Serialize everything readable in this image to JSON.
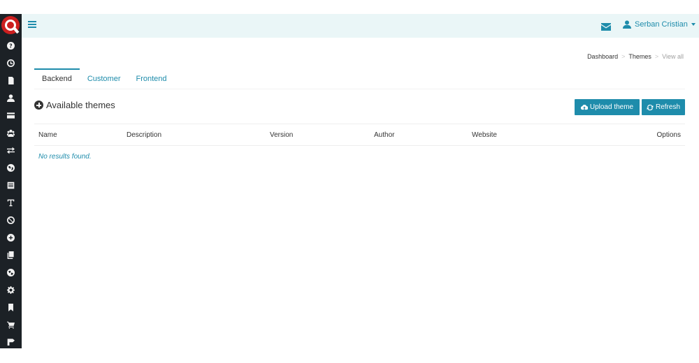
{
  "app": {
    "brand_icon": "app-logo"
  },
  "topbar": {
    "menu_icon": "hamburger-icon",
    "mail_icon": "envelope-icon",
    "user_name": "Serban Cristian",
    "accent": "#1e8cab",
    "background": "#eaf6f7"
  },
  "sidebar": {
    "background": "#1c2126",
    "items": [
      {
        "icon": "help-icon"
      },
      {
        "icon": "clock-icon"
      },
      {
        "icon": "document-icon"
      },
      {
        "icon": "user-icon"
      },
      {
        "icon": "card-icon"
      },
      {
        "icon": "users-icon"
      },
      {
        "icon": "exchange-icon"
      },
      {
        "icon": "globe-icon"
      },
      {
        "icon": "list-icon"
      },
      {
        "icon": "text-icon"
      },
      {
        "icon": "ban-icon"
      },
      {
        "icon": "plus-circle-icon"
      },
      {
        "icon": "copy-icon"
      },
      {
        "icon": "earth-icon"
      },
      {
        "icon": "gear-icon"
      },
      {
        "icon": "bookmark-icon"
      },
      {
        "icon": "cart-icon"
      },
      {
        "icon": "signpost-icon"
      }
    ]
  },
  "breadcrumb": {
    "items": [
      "Dashboard",
      "Themes"
    ],
    "current": "View all"
  },
  "tabs": [
    {
      "label": "Backend",
      "active": true
    },
    {
      "label": "Customer",
      "active": false
    },
    {
      "label": "Frontend",
      "active": false
    }
  ],
  "section": {
    "title": "Available themes"
  },
  "actions": {
    "upload_label": "Upload theme",
    "refresh_label": "Refresh"
  },
  "table": {
    "columns": [
      "Name",
      "Description",
      "Version",
      "Author",
      "Website",
      "Options"
    ],
    "empty_message": "No results found."
  }
}
